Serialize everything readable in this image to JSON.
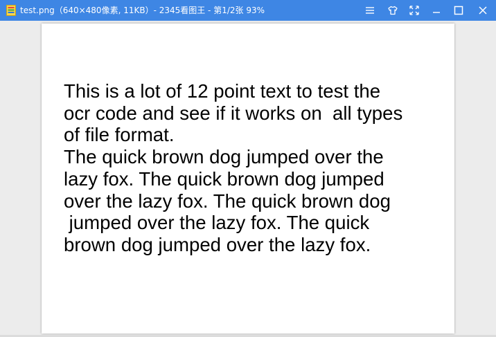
{
  "window": {
    "title": "test.png（640×480像素, 11KB）- 2345看图王 - 第1/2张 93%",
    "accent_color": "#3e86e4",
    "controls": {
      "menu_icon": "menu-icon",
      "skin_icon": "shirt-icon",
      "fullscreen_icon": "fullscreen-icon",
      "minimize_icon": "minimize-icon",
      "maximize_icon": "maximize-icon",
      "close_icon": "close-icon"
    }
  },
  "image": {
    "lines": [
      "This is a lot of 12 point text to test the",
      "ocr code and see if it works on  all types",
      "of file format.",
      "The quick brown dog jumped over the",
      "lazy fox. The quick brown dog jumped",
      "over the lazy fox. The quick brown dog",
      " jumped over the lazy fox. The quick",
      "brown dog jumped over the lazy fox."
    ]
  }
}
